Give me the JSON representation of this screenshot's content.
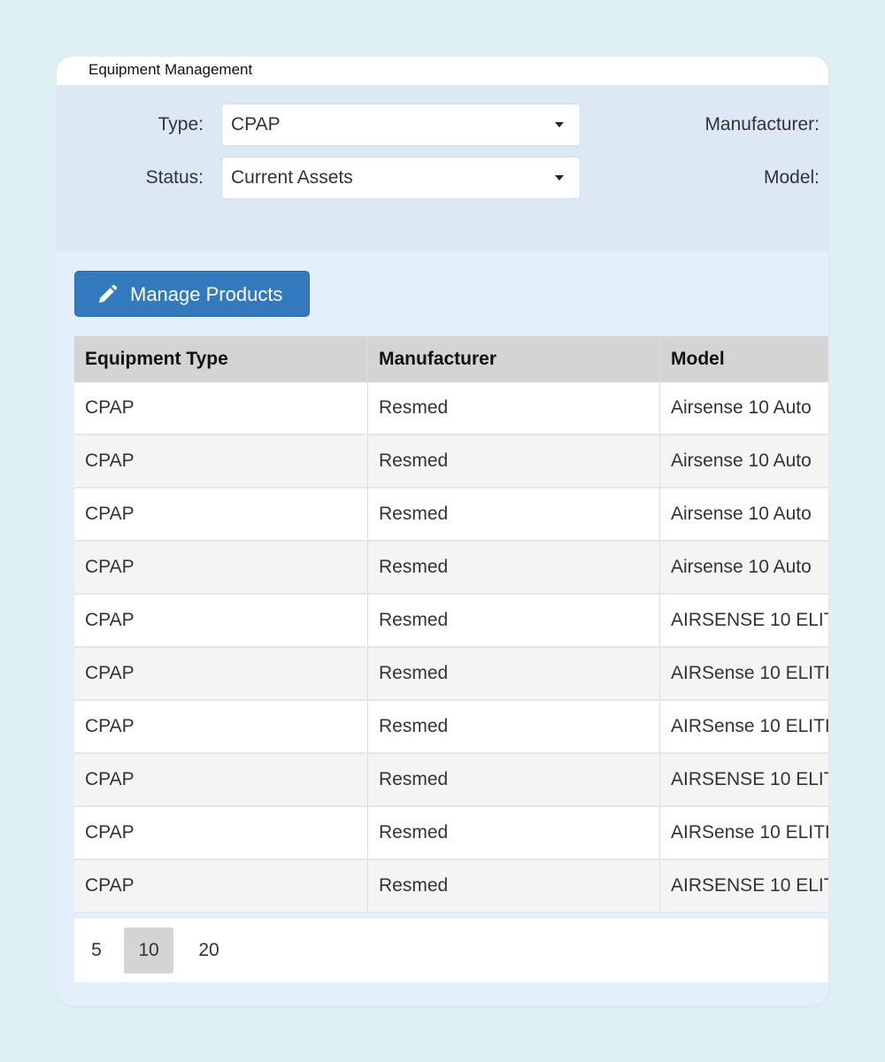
{
  "window": {
    "title": "Equipment Management"
  },
  "filters": {
    "type_label": "Type:",
    "type_value": "CPAP",
    "status_label": "Status:",
    "status_value": "Current Assets",
    "manufacturer_label": "Manufacturer:",
    "model_label": "Model:"
  },
  "toolbar": {
    "manage_products_label": "Manage Products",
    "manage_icon": "pencil-icon"
  },
  "table": {
    "columns": [
      "Equipment Type",
      "Manufacturer",
      "Model"
    ],
    "rows": [
      [
        "CPAP",
        "Resmed",
        "Airsense 10 Auto"
      ],
      [
        "CPAP",
        "Resmed",
        "Airsense 10 Auto"
      ],
      [
        "CPAP",
        "Resmed",
        "Airsense 10 Auto"
      ],
      [
        "CPAP",
        "Resmed",
        "Airsense 10 Auto"
      ],
      [
        "CPAP",
        "Resmed",
        "AIRSENSE 10 ELIT"
      ],
      [
        "CPAP",
        "Resmed",
        "AIRSense 10 ELITI"
      ],
      [
        "CPAP",
        "Resmed",
        "AIRSense 10 ELITI"
      ],
      [
        "CPAP",
        "Resmed",
        "AIRSENSE 10 ELIT"
      ],
      [
        "CPAP",
        "Resmed",
        "AIRSense 10 ELITI"
      ],
      [
        "CPAP",
        "Resmed",
        "AIRSENSE 10 ELIT"
      ]
    ]
  },
  "pager": {
    "sizes": [
      "5",
      "10",
      "20"
    ],
    "active": "10"
  },
  "colors": {
    "accent": "#3279bd",
    "header_bg": "#d4d4d4",
    "panel_bg": "#dce9f5",
    "page_bg": "#dff0f4"
  }
}
